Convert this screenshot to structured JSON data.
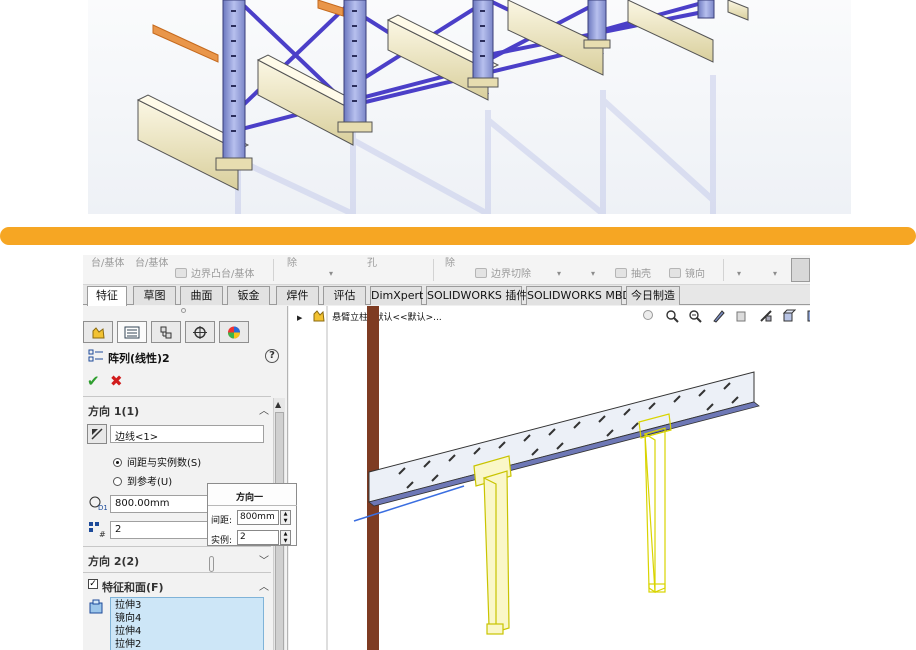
{
  "command_manager": {
    "items": [
      {
        "label": "台/基体",
        "icon": ""
      },
      {
        "label": "台/基体",
        "icon": ""
      },
      {
        "label": "边界凸台/基体",
        "icon": "boundary-boss-icon"
      },
      {
        "label": "除",
        "icon": ""
      },
      {
        "label": "孔",
        "icon": ""
      },
      {
        "label": "除",
        "icon": ""
      },
      {
        "label": "边界切除",
        "icon": "boundary-cut-icon"
      },
      {
        "label": "抽壳",
        "icon": "shell-icon"
      },
      {
        "label": "镜向",
        "icon": "mirror-icon"
      }
    ]
  },
  "tabs": [
    {
      "label": "特征",
      "active": true
    },
    {
      "label": "草图",
      "active": false
    },
    {
      "label": "曲面",
      "active": false
    },
    {
      "label": "钣金",
      "active": false
    },
    {
      "label": "焊件",
      "active": false
    },
    {
      "label": "评估",
      "active": false
    },
    {
      "label": "DimXpert",
      "active": false
    },
    {
      "label": "SOLIDWORKS 插件",
      "active": false
    },
    {
      "label": "SOLIDWORKS MBD",
      "active": false
    },
    {
      "label": "今日制造",
      "active": false
    }
  ],
  "property_manager": {
    "title": "阵列(线性)2",
    "direction1": {
      "title": "方向 1(1)",
      "edge_value": "边线<1>",
      "option_spacing": "间距与实例数(S)",
      "option_reference": "到参考(U)",
      "spacing_value": "800.00mm",
      "instances_value": "2"
    },
    "direction2": {
      "title": "方向 2(2)"
    },
    "features": {
      "title": "特征和面(F)",
      "list": [
        "拉伸3",
        "镜向4",
        "拉伸4",
        "拉伸2"
      ]
    }
  },
  "feature_tree": {
    "root_label": "悬臂立柱 (默认<<默认>..."
  },
  "callout": {
    "title": "方向一",
    "spacing_label": "间距:",
    "spacing_value": "800mm",
    "instances_label": "实例:",
    "instances_value": "2"
  },
  "colors": {
    "accent_bar": "#f6a623",
    "upright_blue": "#8e9bd8",
    "brace_blue": "#4b3fc8",
    "beam_yellow": "#f3eccb",
    "arm_orange": "#e9964a",
    "selection_yellow": "#f5ef0a",
    "post_brown": "#7e3b22"
  }
}
